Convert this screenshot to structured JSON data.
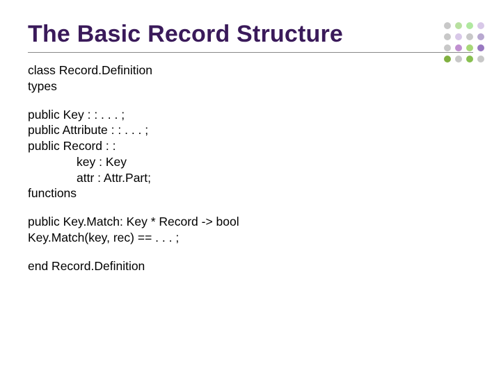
{
  "title": "The Basic Record Structure",
  "lines": {
    "l1": "class Record.Definition",
    "l2": "types",
    "l3": "public Key : : . . . ;",
    "l4": "public Attribute : : . . . ;",
    "l5": "public Record : :",
    "l6": "key : Key",
    "l7": "attr : Attr.Part;",
    "l8": "functions",
    "l9": "public Key.Match: Key * Record -> bool",
    "l10": "Key.Match(key, rec) == . . . ;",
    "l11": "end Record.Definition"
  },
  "dots": [
    "#c8c8c8",
    "#b8e0a0",
    "#b0e8a0",
    "#d8c8e8",
    "#c8c8c8",
    "#d8c8e8",
    "#c8c8c8",
    "#b8a8d0",
    "#c8c8c8",
    "#c090d0",
    "#a8d878",
    "#9878c0",
    "#80b040",
    "#c8c8c8",
    "#88c050",
    "#c8c8c8"
  ],
  "chart_data": null
}
